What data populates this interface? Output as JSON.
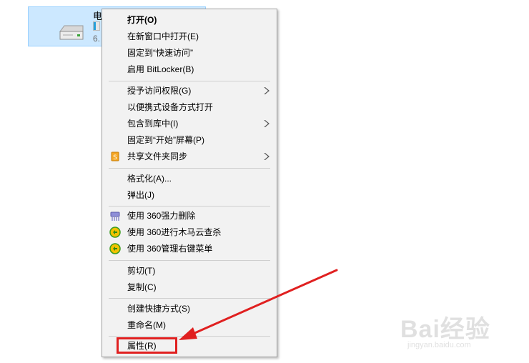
{
  "drive": {
    "name": "电",
    "size_text": "6.",
    "usage_fraction": 0.35,
    "icon": "hard-drive-icon"
  },
  "context_menu": {
    "items": [
      {
        "label": "打开(O)",
        "bold": true
      },
      {
        "label": "在新窗口中打开(E)"
      },
      {
        "label": "固定到“快速访问”"
      },
      {
        "label": "启用 BitLocker(B)"
      },
      {
        "label": "授予访问权限(G)",
        "submenu": true
      },
      {
        "label": "以便携式设备方式打开"
      },
      {
        "label": "包含到库中(I)",
        "submenu": true
      },
      {
        "label": "固定到“开始”屏幕(P)"
      },
      {
        "label": "共享文件夹同步",
        "submenu": true,
        "icon": "sync-share-icon"
      },
      {
        "label": "格式化(A)..."
      },
      {
        "label": "弹出(J)"
      },
      {
        "label": "使用 360强力删除",
        "icon": "shredder-icon"
      },
      {
        "label": "使用 360进行木马云查杀",
        "icon": "360-shield-icon"
      },
      {
        "label": "使用 360管理右键菜单",
        "icon": "360-shield-icon"
      },
      {
        "label": "剪切(T)"
      },
      {
        "label": "复制(C)"
      },
      {
        "label": "创建快捷方式(S)"
      },
      {
        "label": "重命名(M)"
      },
      {
        "label": "属性(R)",
        "highlighted": true
      }
    ]
  },
  "annotation": {
    "arrow_color": "#e02020",
    "highlight_color": "#e02020"
  },
  "watermark": {
    "brand": "Bai经验",
    "url": "jingyan.baidu.com"
  }
}
